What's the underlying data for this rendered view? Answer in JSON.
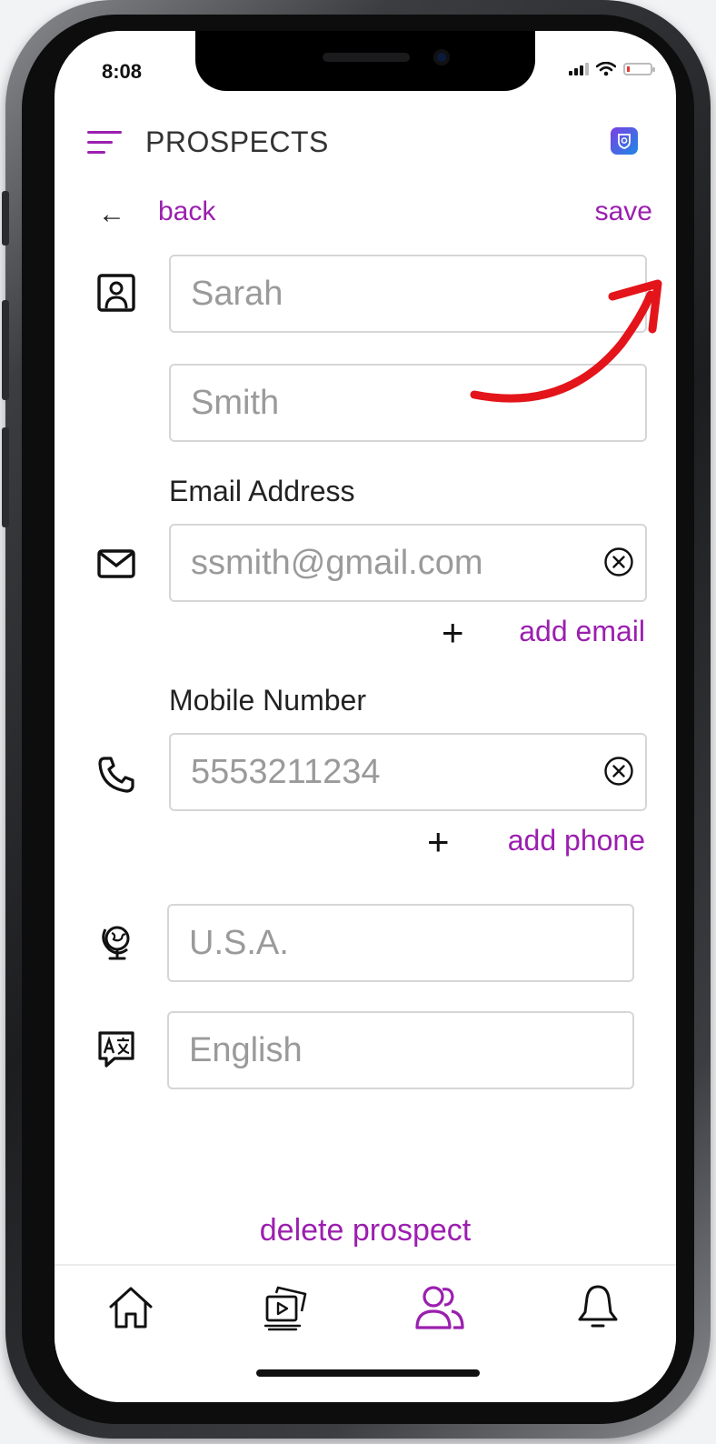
{
  "status_bar": {
    "time": "8:08"
  },
  "header": {
    "title": "PROSPECTS"
  },
  "nav": {
    "back_arrow": "←",
    "back_label": "back",
    "save_label": "save"
  },
  "form": {
    "first_name": {
      "value": "Sarah",
      "icon": "contact-card-icon"
    },
    "last_name": {
      "value": "Smith"
    },
    "email": {
      "label": "Email Address",
      "value": "ssmith@gmail.com",
      "icon": "envelope-icon",
      "add_label": "add email"
    },
    "phone": {
      "label": "Mobile Number",
      "value": "5553211234",
      "icon": "phone-icon",
      "add_label": "add phone"
    },
    "country": {
      "placeholder": "U.S.A.",
      "icon": "globe-icon"
    },
    "language": {
      "placeholder": "English",
      "icon": "translate-icon"
    },
    "plus_symbol": "+"
  },
  "actions": {
    "delete_label": "delete prospect"
  },
  "tabbar": {
    "items": [
      {
        "icon": "home-icon",
        "active": false
      },
      {
        "icon": "media-gallery-icon",
        "active": false
      },
      {
        "icon": "people-icon",
        "active": true
      },
      {
        "icon": "bell-icon",
        "active": false
      }
    ]
  },
  "colors": {
    "accent": "#9b1faf",
    "annotation_arrow": "#e3151b",
    "border": "#d6d6d6"
  }
}
